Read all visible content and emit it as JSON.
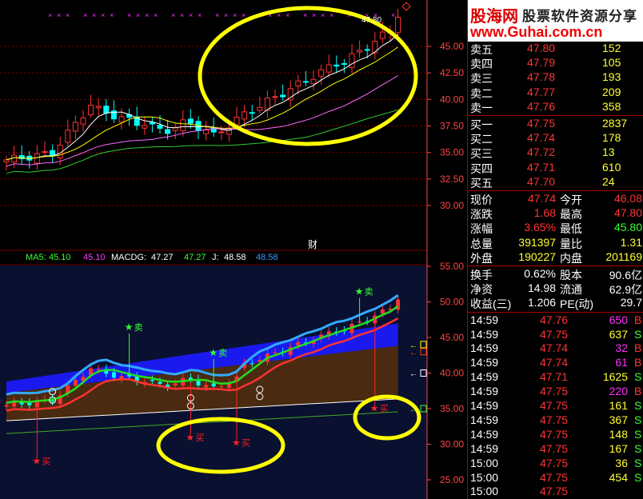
{
  "colors": {
    "up": "#ff3333",
    "down": "#00ffff",
    "flat": "#ffffff",
    "ma_white": "#ffffff",
    "ma_yellow": "#ffff00",
    "ma_pink": "#ff66ff",
    "ma_green": "#33cc33",
    "grid": "#7a0000",
    "axis": "#ff4444",
    "label_white": "#ffffff",
    "label_yellow": "#ffff33",
    "label_green": "#33ff33",
    "label_red": "#ff3333",
    "label_magenta": "#ff33ff",
    "highlight": "#ffff00",
    "buy": "#ff2222",
    "sell": "#33ff33"
  },
  "top_chart": {
    "price_labels": [
      "45.00",
      "42.50",
      "40.00",
      "37.50",
      "35.00",
      "32.50",
      "30.00"
    ],
    "price_values": [
      45.0,
      42.5,
      40.0,
      37.5,
      35.0,
      32.5,
      30.0
    ],
    "peak_label": "47.80",
    "finance_marker": "财"
  },
  "indicator_bar": {
    "ma5_label": "MA5:",
    "ma5_val1": "45.10",
    "ma5_val2": "45.10",
    "macdg_label": "MACDG:",
    "macdg_val1": "47.27",
    "macdg_val2": "47.27",
    "j_label": "J:",
    "j_val1": "48.58",
    "j_val2": "48.58"
  },
  "bottom_chart": {
    "price_labels": [
      "55.00",
      "50.00",
      "45.00",
      "40.00",
      "35.00",
      "30.00",
      "25.00"
    ],
    "price_values": [
      55,
      50,
      45,
      40,
      35,
      30,
      25
    ],
    "buy_label": "买",
    "sell_label": "卖"
  },
  "logo": {
    "cn": "股海网",
    "slogan": "股票软件资源分享",
    "url": "www.Guhai.com.cn"
  },
  "order_book": {
    "asks": [
      {
        "label": "卖五",
        "price": "47.80",
        "vol": "152"
      },
      {
        "label": "卖四",
        "price": "47.79",
        "vol": "105"
      },
      {
        "label": "卖三",
        "price": "47.78",
        "vol": "193"
      },
      {
        "label": "卖二",
        "price": "47.77",
        "vol": "209"
      },
      {
        "label": "卖一",
        "price": "47.76",
        "vol": "358"
      }
    ],
    "bids": [
      {
        "label": "买一",
        "price": "47.75",
        "vol": "2837"
      },
      {
        "label": "买二",
        "price": "47.74",
        "vol": "178"
      },
      {
        "label": "买三",
        "price": "47.72",
        "vol": "13"
      },
      {
        "label": "买四",
        "price": "47.71",
        "vol": "610"
      },
      {
        "label": "买五",
        "price": "47.70",
        "vol": "24"
      }
    ]
  },
  "quote": {
    "rows": [
      {
        "k1": "现价",
        "v1": "47.74",
        "k2": "今开",
        "v2": "46.08"
      },
      {
        "k1": "涨跌",
        "v1": "1.68",
        "k2": "最高",
        "v2": "47.80"
      },
      {
        "k1": "涨幅",
        "v1": "3.65%",
        "k2": "最低",
        "v2": "45.80"
      },
      {
        "k1": "总量",
        "v1": "391397",
        "k2": "量比",
        "v2": "1.31"
      },
      {
        "k1": "外盘",
        "v1": "190227",
        "k2": "内盘",
        "v2": "201169"
      }
    ],
    "rows2": [
      {
        "k1": "换手",
        "v1": "0.62%",
        "k2": "股本",
        "v2": "90.6亿"
      },
      {
        "k1": "净资",
        "v1": "14.98",
        "k2": "流通",
        "v2": "62.9亿"
      },
      {
        "k1": "收益(三)",
        "v1": "1.206",
        "k2": "PE(动)",
        "v2": "29.7"
      }
    ]
  },
  "ticks": [
    {
      "time": "14:59",
      "price": "47.76",
      "vol": "650",
      "side": "B"
    },
    {
      "time": "14:59",
      "price": "47.75",
      "vol": "637",
      "side": "S"
    },
    {
      "time": "14:59",
      "price": "47.74",
      "vol": "32",
      "side": "B"
    },
    {
      "time": "14:59",
      "price": "47.74",
      "vol": "61",
      "side": "B"
    },
    {
      "time": "14:59",
      "price": "47.71",
      "vol": "1625",
      "side": "S"
    },
    {
      "time": "14:59",
      "price": "47.75",
      "vol": "220",
      "side": "B"
    },
    {
      "time": "14:59",
      "price": "47.75",
      "vol": "161",
      "side": "S"
    },
    {
      "time": "14:59",
      "price": "47.75",
      "vol": "367",
      "side": "S"
    },
    {
      "time": "14:59",
      "price": "47.75",
      "vol": "148",
      "side": "S"
    },
    {
      "time": "14:59",
      "price": "47.75",
      "vol": "167",
      "side": "S"
    },
    {
      "time": "15:00",
      "price": "47.75",
      "vol": "36",
      "side": "S"
    },
    {
      "time": "15:00",
      "price": "47.75",
      "vol": "454",
      "side": "S"
    },
    {
      "time": "15:00",
      "price": "47.75",
      "vol": "",
      "side": ""
    }
  ]
}
